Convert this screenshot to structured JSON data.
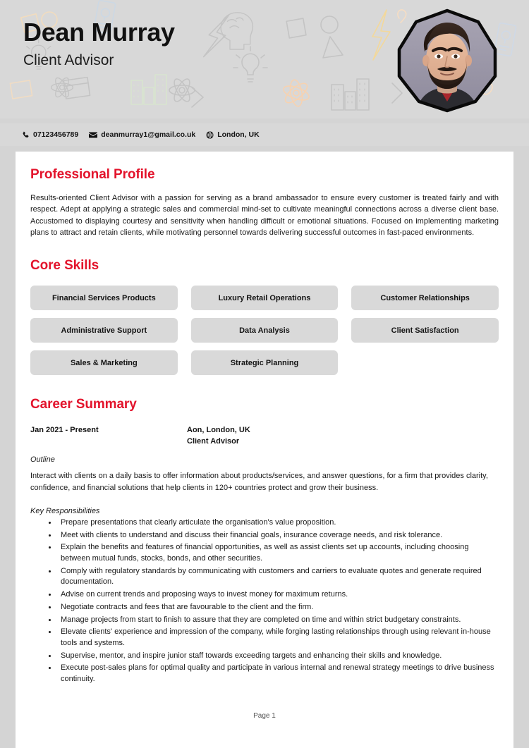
{
  "header": {
    "name": "Dean Murray",
    "job_title": "Client Advisor",
    "photo_alt": "profile-photo",
    "background_color": "#d8d8d8"
  },
  "contact": {
    "phone": "07123456789",
    "email": "deanmurray1@gmail.co.uk",
    "location": "London, UK",
    "phone_icon": "phone-icon",
    "email_icon": "envelope-icon",
    "location_icon": "globe-icon"
  },
  "accent_color": "#e3142c",
  "pill_color": "#d9d9d9",
  "sections": {
    "profile": {
      "title": "Professional Profile",
      "text": "Results-oriented Client Advisor with a passion for serving as a brand ambassador to ensure every customer is treated fairly and with respect. Adept at applying a strategic sales and commercial mind-set to cultivate meaningful connections across a diverse client base. Accustomed to displaying courtesy and sensitivity when handling difficult or emotional situations. Focused on implementing marketing plans to attract and retain clients, while motivating personnel towards delivering successful outcomes in fast-paced environments."
    },
    "skills": {
      "title": "Core Skills",
      "items": [
        "Financial Services Products",
        "Luxury Retail Operations",
        "Customer Relationships",
        "Administrative Support",
        "Data Analysis",
        "Client Satisfaction",
        "Sales & Marketing",
        "Strategic Planning"
      ]
    },
    "career": {
      "title": "Career Summary",
      "job": {
        "dates": "Jan 2021 - Present",
        "employer": "Aon, London, UK",
        "role": "Client Advisor",
        "outline_label": "Outline",
        "outline_text": "Interact with clients on a daily basis to offer information about products/services, and answer questions, for a firm that provides clarity, confidence, and financial solutions that help clients in 120+ countries protect and grow their business.",
        "responsibilities_label": "Key Responsibilities",
        "responsibilities": [
          "Prepare presentations that clearly articulate the organisation's value proposition.",
          "Meet with clients to understand and discuss their financial goals, insurance coverage needs, and risk tolerance.",
          "Explain the benefits and features of financial opportunities, as well as assist clients set up accounts, including choosing between mutual funds, stocks, bonds, and other securities.",
          "Comply with regulatory standards by communicating with customers and carriers to evaluate quotes and generate required documentation.",
          "Advise on current trends and proposing ways to invest money for maximum returns.",
          "Negotiate contracts and fees that are favourable to the client and the firm.",
          "Manage projects from start to finish to assure that they are completed on time and within strict budgetary constraints.",
          "Elevate clients' experience and impression of the company, while forging lasting relationships through using relevant in-house tools and systems.",
          "Supervise, mentor, and inspire junior staff towards exceeding targets and enhancing their skills and knowledge.",
          "Execute post-sales plans for optimal quality and participate in various internal and renewal strategy meetings to drive business continuity."
        ]
      }
    }
  },
  "footer": {
    "page_label": "Page 1"
  }
}
